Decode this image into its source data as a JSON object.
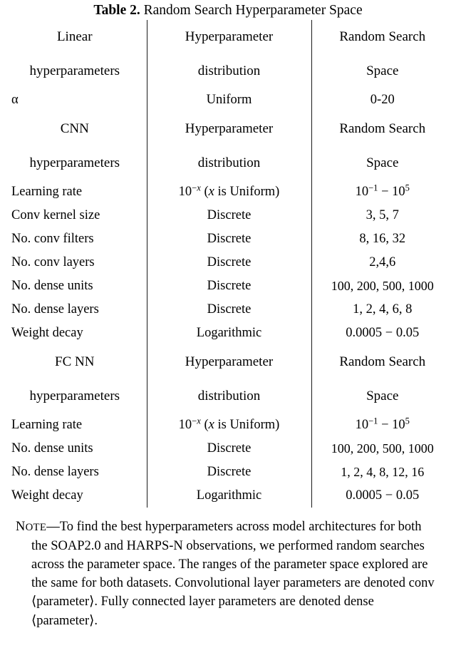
{
  "caption": {
    "label": "Table 2.",
    "text": "Random Search Hyperparameter Space"
  },
  "table": {
    "sections": [
      {
        "header": {
          "col1_line1": "Linear",
          "col1_line2": "hyperparameters",
          "col2_line1": "Hyperparameter",
          "col2_line2": "distribution",
          "col3_line1": "Random Search",
          "col3_line2": "Space"
        },
        "rows": [
          {
            "param": "α",
            "distribution": "Uniform",
            "space": "0-20"
          }
        ]
      },
      {
        "header": {
          "col1_line1": "CNN",
          "col1_line2": "hyperparameters",
          "col2_line1": "Hyperparameter",
          "col2_line2": "distribution",
          "col3_line1": "Random Search",
          "col3_line2": "Space"
        },
        "rows": [
          {
            "param": "Learning rate",
            "distribution": "10⁻ˣ (x is Uniform)",
            "space": "10⁻¹ − 10⁵"
          },
          {
            "param": "Conv kernel size",
            "distribution": "Discrete",
            "space": "3, 5, 7"
          },
          {
            "param": "No. conv filters",
            "distribution": "Discrete",
            "space": "8, 16, 32"
          },
          {
            "param": "No. conv layers",
            "distribution": "Discrete",
            "space": "2,4,6"
          },
          {
            "param": "No. dense units",
            "distribution": "Discrete",
            "space": "100, 200, 500, 1000"
          },
          {
            "param": "No. dense layers",
            "distribution": "Discrete",
            "space": "1, 2, 4, 6, 8"
          },
          {
            "param": "Weight decay",
            "distribution": "Logarithmic",
            "space": "0.0005 − 0.05"
          }
        ]
      },
      {
        "header": {
          "col1_line1": "FC NN",
          "col1_line2": "hyperparameters",
          "col2_line1": "Hyperparameter",
          "col2_line2": "distribution",
          "col3_line1": "Random Search",
          "col3_line2": "Space"
        },
        "rows": [
          {
            "param": "Learning rate",
            "distribution": "10⁻ˣ (x is Uniform)",
            "space": "10⁻¹ − 10⁵"
          },
          {
            "param": "No. dense units",
            "distribution": "Discrete",
            "space": "100, 200, 500, 1000"
          },
          {
            "param": "No. dense layers",
            "distribution": "Discrete",
            "space": "1, 2, 4, 8, 12, 16"
          },
          {
            "param": "Weight decay",
            "distribution": "Logarithmic",
            "space": "0.0005 − 0.05"
          }
        ]
      }
    ]
  },
  "note": {
    "label_first": "N",
    "label_rest": "OTE",
    "dash": "—",
    "body": "To find the best hyperparameters across model architectures for both the SOAP2.0 and HARPS-N observations, we performed random searches across the parameter space. The ranges of the parameter space explored are the same for both datasets. Convolutional layer parameters are denoted conv ⟨parameter⟩. Fully connected layer parameters are denoted dense ⟨parameter⟩."
  }
}
